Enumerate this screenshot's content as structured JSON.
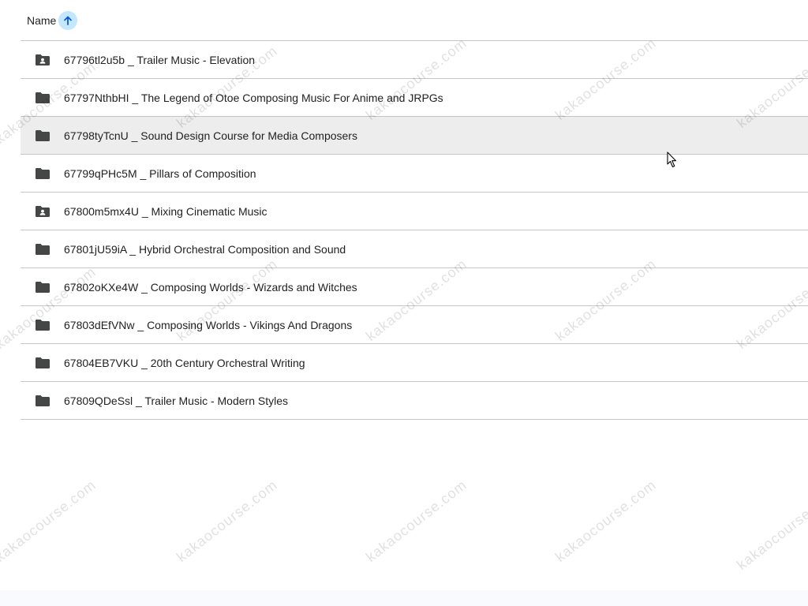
{
  "header": {
    "column_label": "Name",
    "sort_icon": "arrow-up-icon",
    "sort_direction": "ascending"
  },
  "colors": {
    "sort_badge": "#c2e7ff",
    "selected_row": "#ededed",
    "divider": "#c4c7c5",
    "folder_icon": "#444746"
  },
  "rows": [
    {
      "name": "67796tl2u5b _ Trailer Music - Elevation",
      "icon": "shared-folder-icon",
      "selected": false
    },
    {
      "name": "67797NthbHI _ The Legend of Otoe Composing Music For Anime and JRPGs",
      "icon": "folder-icon",
      "selected": false
    },
    {
      "name": "67798tyTcnU _ Sound Design Course for Media Composers",
      "icon": "folder-icon",
      "selected": true
    },
    {
      "name": "67799qPHc5M _ Pillars of Composition",
      "icon": "folder-icon",
      "selected": false
    },
    {
      "name": "67800m5mx4U _ Mixing Cinematic Music",
      "icon": "shared-folder-icon",
      "selected": false
    },
    {
      "name": "67801jU59iA _ Hybrid Orchestral Composition and Sound",
      "icon": "folder-icon",
      "selected": false
    },
    {
      "name": "67802oKXe4W _ Composing Worlds - Wizards and Witches",
      "icon": "folder-icon",
      "selected": false
    },
    {
      "name": "67803dEfVNw _ Composing Worlds - Vikings And Dragons",
      "icon": "folder-icon",
      "selected": false
    },
    {
      "name": "67804EB7VKU _ 20th Century Orchestral Writing",
      "icon": "folder-icon",
      "selected": false
    },
    {
      "name": "67809QDeSsl _ Trailer Music - Modern Styles",
      "icon": "folder-icon",
      "selected": false
    }
  ],
  "watermark": {
    "text": "kakaocourse.com"
  }
}
